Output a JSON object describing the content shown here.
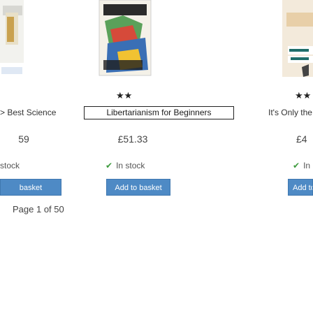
{
  "products": [
    {
      "title": "> Best Science",
      "rating_stars": "",
      "price": "59",
      "stock": "stock",
      "in_stock": true,
      "button_label": "basket"
    },
    {
      "title": "Libertarianism for Beginners",
      "rating_stars": "★★",
      "price": "£51.33",
      "stock": "In stock",
      "in_stock": true,
      "button_label": "Add to basket"
    },
    {
      "title": "It's Only the",
      "rating_stars": "★★",
      "price": "£4",
      "stock": "In",
      "in_stock": true,
      "button_label": "Add to"
    }
  ],
  "pager": {
    "label": "Page 1 of 50"
  },
  "colors": {
    "button": "#4e8ac5",
    "stock_tick": "#3c9a3c"
  }
}
